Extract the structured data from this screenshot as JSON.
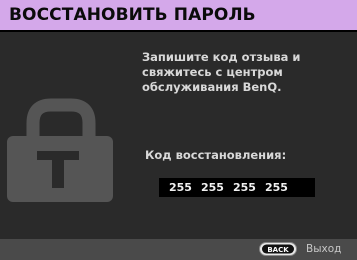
{
  "title": "ВОССТАНОВИТЬ ПАРОЛЬ",
  "instruction_lines": [
    "Запишите код отзыва и",
    "свяжитесь с центром",
    "обслуживания BenQ."
  ],
  "code_label": "Код восстановления:",
  "recovery_code": [
    "255",
    "255",
    "255",
    "255"
  ],
  "footer": {
    "back_key": "BACK",
    "exit_label": "Выход"
  },
  "icons": {
    "lock": "lock-icon"
  },
  "colors": {
    "title_bar": "#d4a8ea",
    "panel": "#2a2a2a",
    "footer": "#4a4a4a",
    "code_box": "#000000"
  }
}
